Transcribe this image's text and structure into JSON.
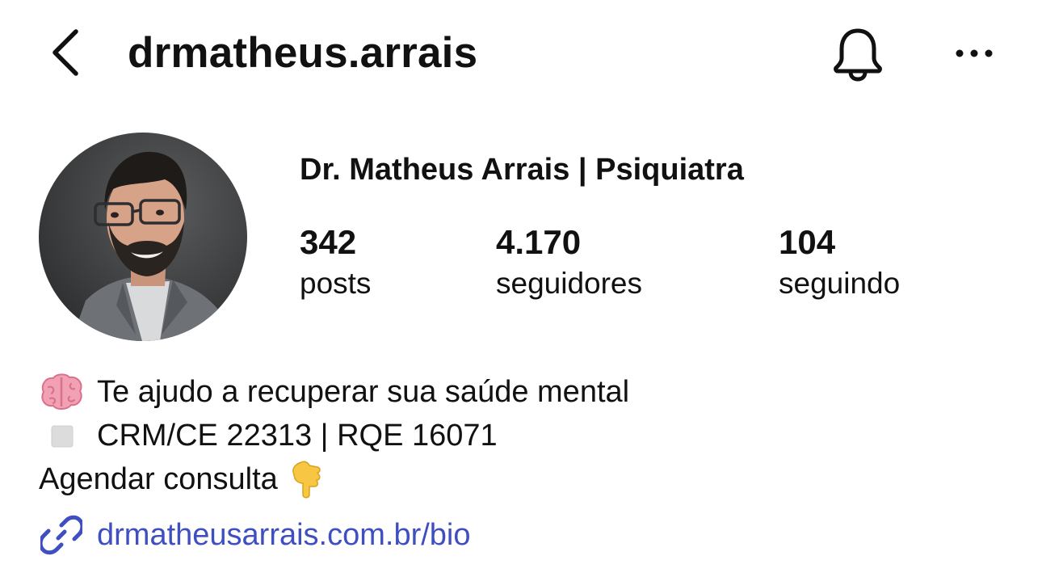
{
  "header": {
    "username": "drmatheus.arrais",
    "icons": {
      "back": "chevron-left-icon",
      "notifications": "bell-icon",
      "more": "more-horizontal-icon"
    }
  },
  "profile": {
    "display_name": "Dr. Matheus Arrais | Psiquiatra",
    "avatar": "profile-photo",
    "stats": [
      {
        "value": "342",
        "label": "posts"
      },
      {
        "value": "4.170",
        "label": "seguidores"
      },
      {
        "value": "104",
        "label": "seguindo"
      }
    ]
  },
  "bio": {
    "lines": [
      {
        "icon": "brain-emoji",
        "text": "Te ajudo a recuperar sua saúde mental"
      },
      {
        "icon": "white-square-emoji",
        "text": "CRM/CE 22313 | RQE 16071"
      },
      {
        "text": "Agendar consulta",
        "trailing_icon": "backhand-pointing-down-emoji"
      }
    ],
    "link": {
      "icon": "link-icon",
      "text": "drmatheusarrais.com.br/bio",
      "color": "#3f4fbf"
    }
  }
}
